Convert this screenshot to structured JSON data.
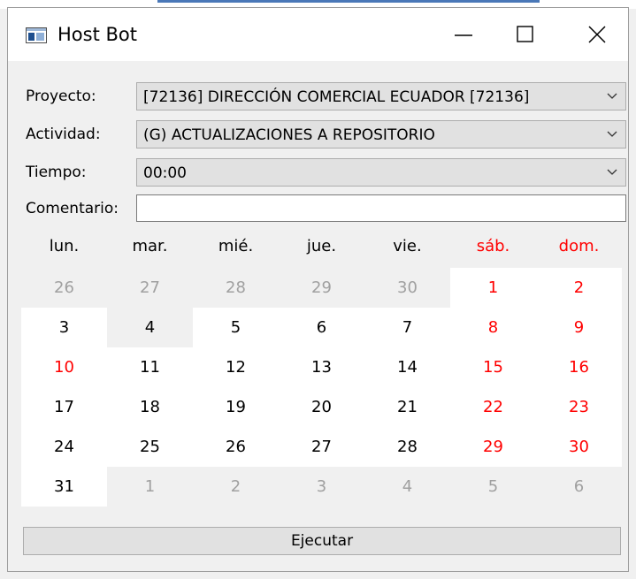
{
  "window": {
    "title": "Host Bot",
    "controls": [
      "minimize-icon",
      "maximize-icon",
      "close-icon"
    ]
  },
  "form": {
    "proyecto_label": "Proyecto:",
    "proyecto_value": "[72136] DIRECCIÓN COMERCIAL ECUADOR [72136]",
    "actividad_label": "Actividad:",
    "actividad_value": "(G) ACTUALIZACIONES A REPOSITORIO",
    "tiempo_label": "Tiempo:",
    "tiempo_value": "00:00",
    "comentario_label": "Comentario:",
    "comentario_value": ""
  },
  "calendar": {
    "day_names": [
      "lun.",
      "mar.",
      "mié.",
      "jue.",
      "vie.",
      "sáb.",
      "dom."
    ],
    "weekend_color": "#ff0000",
    "other_month_color": "#a0a0a0",
    "weeks": [
      [
        {
          "d": "26",
          "other": true
        },
        {
          "d": "27",
          "other": true
        },
        {
          "d": "28",
          "other": true
        },
        {
          "d": "29",
          "other": true
        },
        {
          "d": "30",
          "other": true
        },
        {
          "d": "1"
        },
        {
          "d": "2"
        }
      ],
      [
        {
          "d": "3"
        },
        {
          "d": "4",
          "today": true
        },
        {
          "d": "5"
        },
        {
          "d": "6"
        },
        {
          "d": "7"
        },
        {
          "d": "8"
        },
        {
          "d": "9"
        }
      ],
      [
        {
          "d": "10",
          "holiday": true
        },
        {
          "d": "11"
        },
        {
          "d": "12"
        },
        {
          "d": "13"
        },
        {
          "d": "14"
        },
        {
          "d": "15"
        },
        {
          "d": "16"
        }
      ],
      [
        {
          "d": "17"
        },
        {
          "d": "18"
        },
        {
          "d": "19"
        },
        {
          "d": "20"
        },
        {
          "d": "21"
        },
        {
          "d": "22"
        },
        {
          "d": "23"
        }
      ],
      [
        {
          "d": "24"
        },
        {
          "d": "25"
        },
        {
          "d": "26"
        },
        {
          "d": "27"
        },
        {
          "d": "28"
        },
        {
          "d": "29"
        },
        {
          "d": "30"
        }
      ],
      [
        {
          "d": "31"
        },
        {
          "d": "1",
          "other": true
        },
        {
          "d": "2",
          "other": true
        },
        {
          "d": "3",
          "other": true
        },
        {
          "d": "4",
          "other": true
        },
        {
          "d": "5",
          "other": true
        },
        {
          "d": "6",
          "other": true
        }
      ]
    ]
  },
  "actions": {
    "execute_label": "Ejecutar"
  }
}
